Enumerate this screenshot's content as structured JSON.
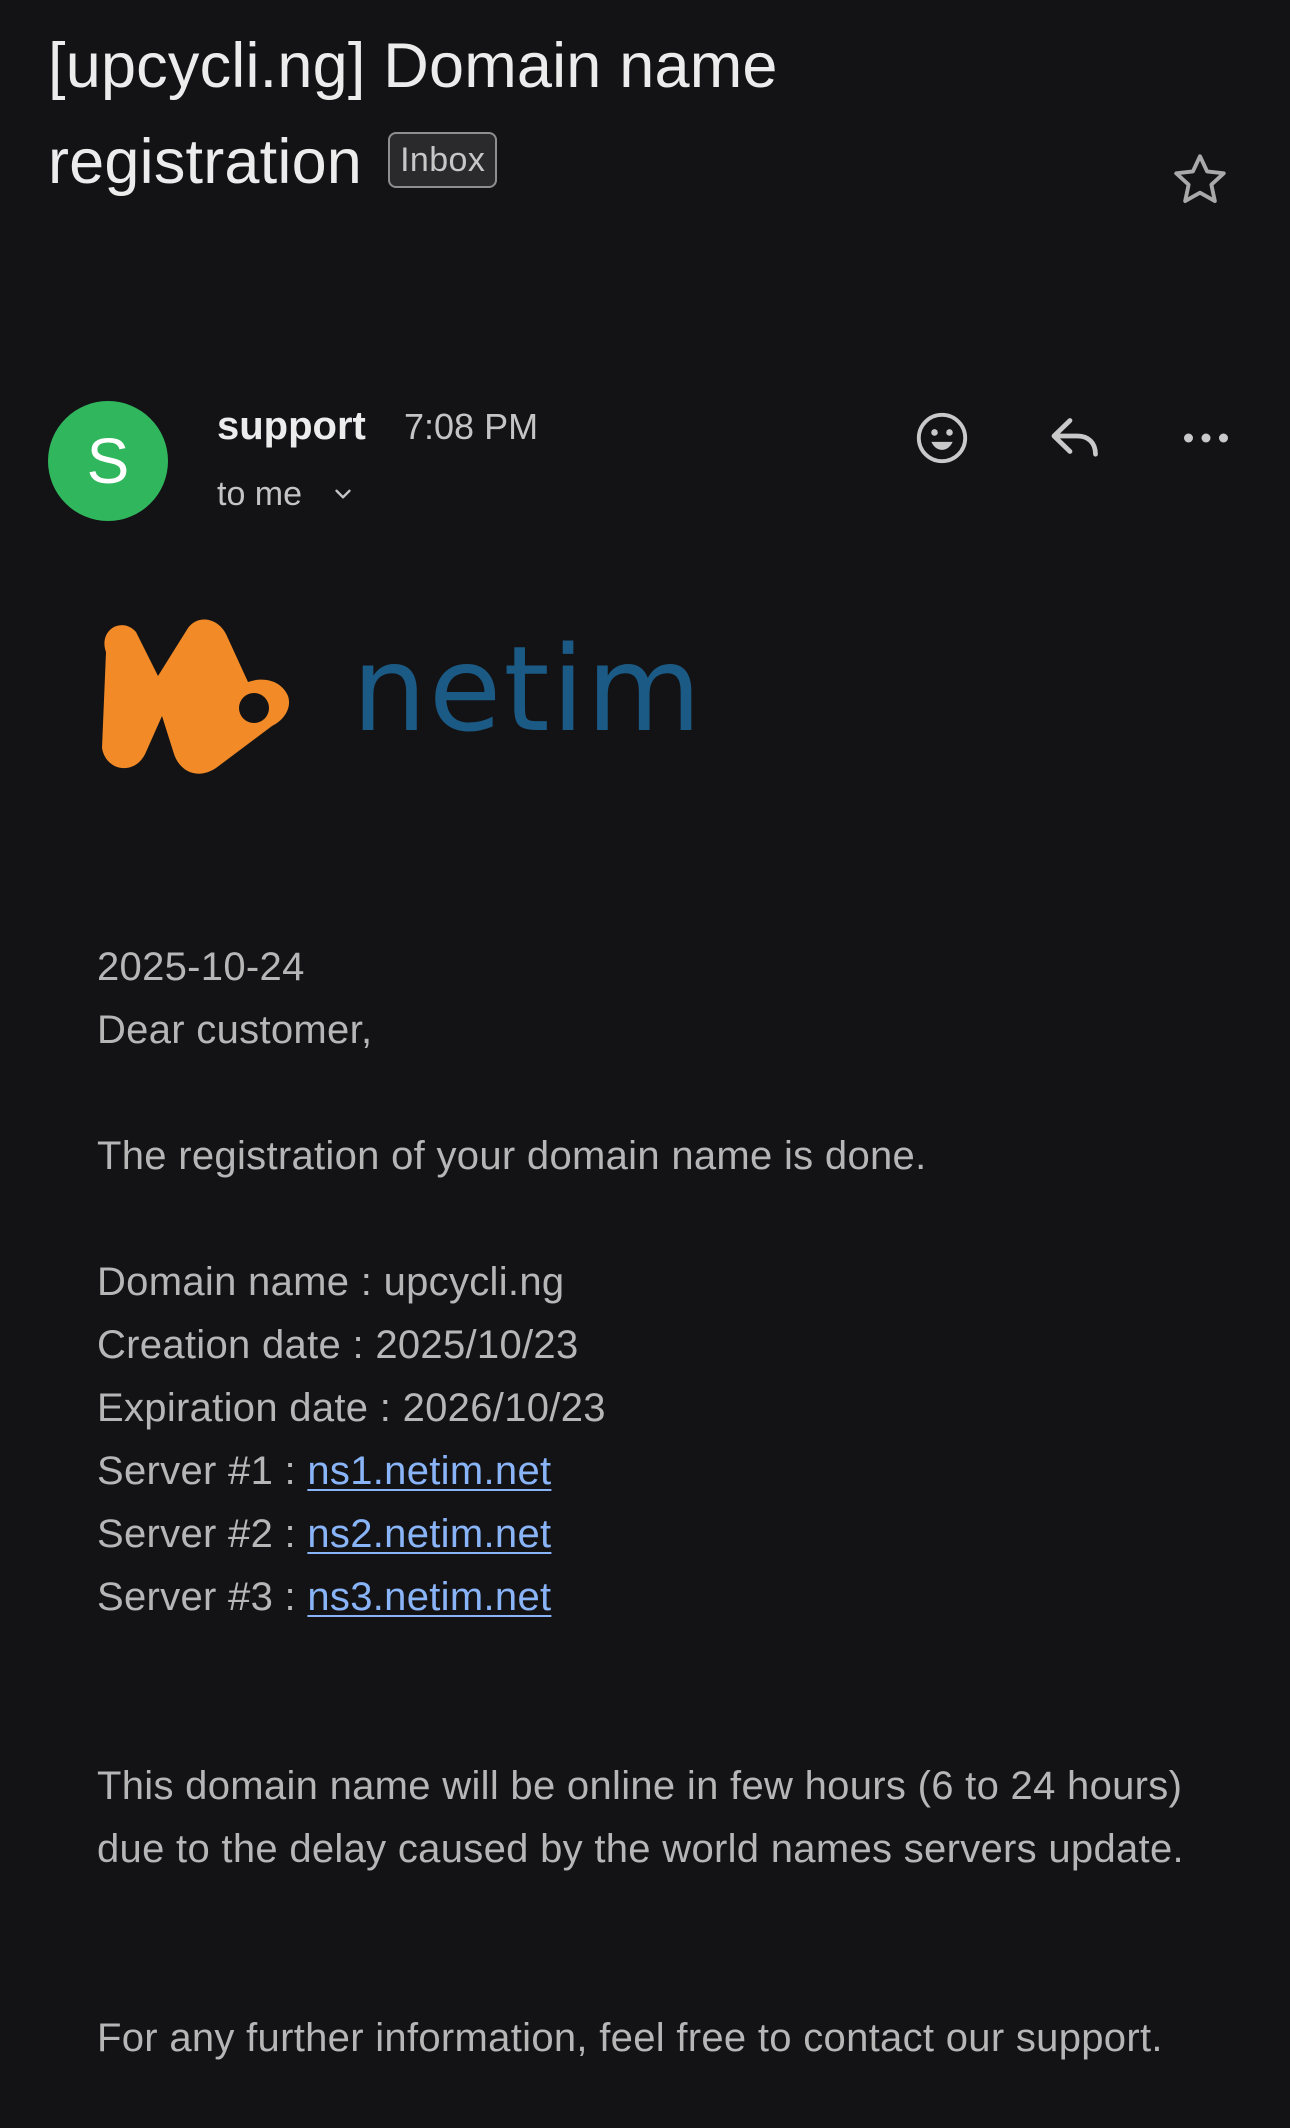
{
  "email": {
    "subject_line1": "[upcycli.ng] Domain name",
    "subject_line2": "registration",
    "label": "Inbox",
    "sender": {
      "initial": "S",
      "avatar_color": "#30b65c",
      "name": "support",
      "time": "7:08 PM",
      "recipient": "to me"
    },
    "icons": {
      "star": "star-icon",
      "emoji": "emoji-icon",
      "reply": "reply-icon",
      "more": "more-horiz-icon",
      "expand": "chevron-down-icon"
    }
  },
  "message": {
    "logo": {
      "wordmark": "netim",
      "mark_color": "#f28a27",
      "wordmark_color": "#1b5a84"
    },
    "date": "2025-10-24",
    "greeting": "Dear customer,",
    "intro": "The registration of your domain name is done.",
    "details": [
      {
        "label": "Domain name :",
        "value": "upcycli.ng"
      },
      {
        "label": "Creation date :",
        "value": "2025/10/23"
      },
      {
        "label": "Expiration date :",
        "value": "2026/10/23"
      }
    ],
    "servers": [
      {
        "label": "Server #1 :",
        "value": "ns1.netim.net"
      },
      {
        "label": "Server #2 :",
        "value": "ns2.netim.net"
      },
      {
        "label": "Server #3 :",
        "value": "ns3.netim.net"
      }
    ],
    "online_note": "This domain name will be online in few hours (6 to 24 hours) due to the delay caused by the world names servers update.",
    "support_note": "For any further information, feel free to contact our support.",
    "link_color": "#8ab4f8"
  }
}
